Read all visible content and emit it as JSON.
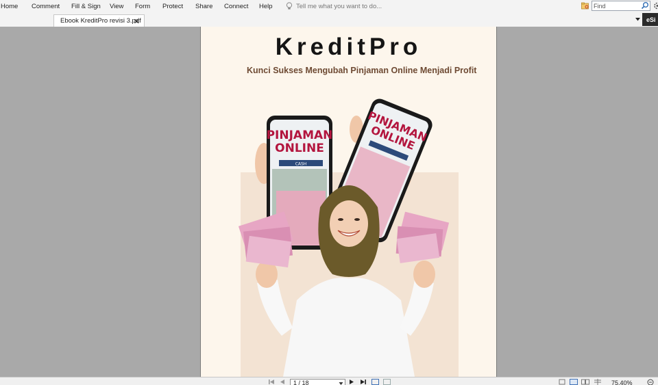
{
  "menu": {
    "items": [
      "Home",
      "Comment",
      "Fill & Sign",
      "View",
      "Form",
      "Protect",
      "Share",
      "Connect",
      "Help"
    ],
    "tell_me_placeholder": "Tell me what you want to do...",
    "find_placeholder": "Find"
  },
  "tabs": {
    "document_tab": "Ebook KreditPro revisi 3.pdf",
    "close_glyph": "✕",
    "esign_label": "eSi"
  },
  "document": {
    "title": "KreditPro",
    "subtitle": "Kunci Sukses Mengubah Pinjaman Online Menjadi Profit",
    "phone_text_line1": "PINJAMAN",
    "phone_text_line2": "ONLINE",
    "phone_cash_label": "CASH"
  },
  "statusbar": {
    "page_indicator": "1 / 18",
    "zoom": "75.40%"
  },
  "colors": {
    "page_bg": "#fdf6ec",
    "subtitle": "#6e4a33",
    "phone_text": "#b3153e",
    "hijab": "#6b5a2a",
    "backdrop": "#f3e3d3"
  },
  "icons": [
    "lightbulb-icon",
    "search-icon",
    "gear-icon",
    "close-icon",
    "chevron-down-icon",
    "find-folder-icon",
    "first-page-icon",
    "prev-page-icon",
    "next-page-icon",
    "last-page-icon",
    "view-mode-icon"
  ]
}
